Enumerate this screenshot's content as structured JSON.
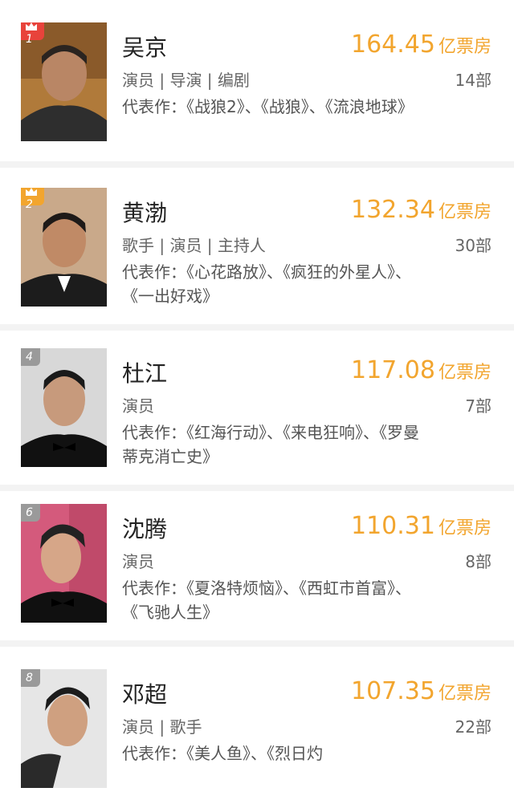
{
  "items": [
    {
      "rank": "1",
      "name": "吴京",
      "roles": "演员 | 导演 | 编剧",
      "box_office": "164.45",
      "unit": "亿票房",
      "film_count": "14部",
      "works": "代表作：《战狼2》、《战狼》、《流浪地球》",
      "badge_color": "#e8433b"
    },
    {
      "rank": "2",
      "name": "黄渤",
      "roles": "歌手 | 演员 | 主持人",
      "box_office": "132.34",
      "unit": "亿票房",
      "film_count": "30部",
      "works": "代表作：《心花路放》、《疯狂的外星人》、《一出好戏》",
      "badge_color": "#f2a52e"
    },
    {
      "rank": "4",
      "name": "杜江",
      "roles": "演员",
      "box_office": "117.08",
      "unit": "亿票房",
      "film_count": "7部",
      "works": "代表作：《红海行动》、《来电狂响》、《罗曼蒂克消亡史》",
      "badge_color": "#9a9a9a"
    },
    {
      "rank": "6",
      "name": "沈腾",
      "roles": "演员",
      "box_office": "110.31",
      "unit": "亿票房",
      "film_count": "8部",
      "works": "代表作：《夏洛特烦恼》、《西虹市首富》、《飞驰人生》",
      "badge_color": "#9a9a9a"
    },
    {
      "rank": "8",
      "name": "邓超",
      "roles": "演员 | 歌手",
      "box_office": "107.35",
      "unit": "亿票房",
      "film_count": "22部",
      "works": "代表作：《美人鱼》、《烈日灼",
      "badge_color": "#9a9a9a"
    }
  ],
  "colors": {
    "accent": "#f2a52e",
    "rank1": "#e8433b",
    "separator": "#f3f3f3"
  },
  "icons": {
    "crown": "crown-icon"
  }
}
